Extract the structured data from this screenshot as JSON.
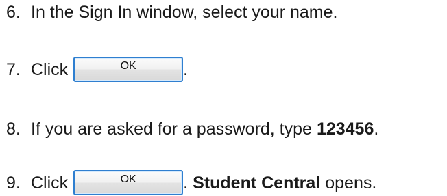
{
  "steps": [
    {
      "number": "6.",
      "text": "In the Sign In window, select your name."
    },
    {
      "number": "7.",
      "text": "Click",
      "after": "."
    },
    {
      "number": "8.",
      "text": "If you are asked for a password, type",
      "bold": "123456",
      "after": "."
    },
    {
      "number": "9.",
      "text": "Click",
      "after": ".",
      "bold": "Student Central",
      "tail": "opens."
    }
  ],
  "buttons": {
    "ok_label": "OK"
  }
}
